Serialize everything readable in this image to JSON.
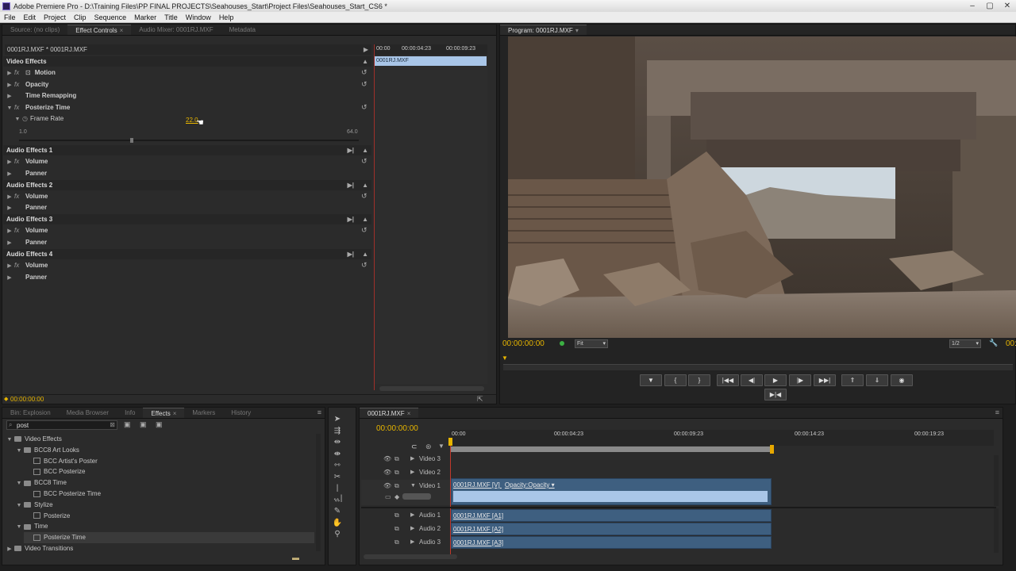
{
  "window": {
    "title": "Adobe Premiere Pro - D:\\Training Files\\PP FINAL PROJECTS\\Seahouses_Start\\Project Files\\Seahouses_Start_CS6 *"
  },
  "menu": [
    "File",
    "Edit",
    "Project",
    "Clip",
    "Sequence",
    "Marker",
    "Title",
    "Window",
    "Help"
  ],
  "top_left_tabs": [
    {
      "label": "Source: (no clips)"
    },
    {
      "label": "Effect Controls"
    },
    {
      "label": "Audio Mixer: 0001RJ.MXF"
    },
    {
      "label": "Metadata"
    }
  ],
  "effect_controls": {
    "header_clip": "0001RJ.MXF * 0001RJ.MXF",
    "ruler": [
      "00:00",
      "00:00:04:23",
      "00:00:09:23"
    ],
    "clip_label": "0001RJ.MXF",
    "sections": {
      "video": "Video Effects",
      "motion": "Motion",
      "opacity": "Opacity",
      "time_remapping": "Time Remapping",
      "posterize": "Posterize Time",
      "frame_rate_label": "Frame Rate",
      "frame_rate_value": "22.0",
      "slider_min": "1.0",
      "slider_max": "64.0",
      "audio1": "Audio Effects 1",
      "audio2": "Audio Effects 2",
      "audio3": "Audio Effects 3",
      "audio4": "Audio Effects 4",
      "volume": "Volume",
      "panner": "Panner"
    },
    "timecode": "00:00:00:00"
  },
  "program": {
    "tab": "Program: 0001RJ.MXF",
    "timecode": "00:00:00:00",
    "fit": "Fit",
    "resolution": "1/2",
    "end_timecode": "00:"
  },
  "bottom_left_tabs": [
    {
      "label": "Bin: Explosion"
    },
    {
      "label": "Media Browser"
    },
    {
      "label": "Info"
    },
    {
      "label": "Effects"
    },
    {
      "label": "Markers"
    },
    {
      "label": "History"
    }
  ],
  "effects_panel": {
    "search_value": "post",
    "tree": [
      {
        "label": "Video Effects",
        "indent": 0,
        "type": "folder",
        "tri": "▼"
      },
      {
        "label": "BCC8 Art Looks",
        "indent": 1,
        "type": "folder",
        "tri": "▼"
      },
      {
        "label": "BCC Artist's Poster",
        "indent": 2,
        "type": "fx",
        "tri": ""
      },
      {
        "label": "BCC Posterize",
        "indent": 2,
        "type": "fx",
        "tri": ""
      },
      {
        "label": "BCC8 Time",
        "indent": 1,
        "type": "folder",
        "tri": "▼"
      },
      {
        "label": "BCC Posterize Time",
        "indent": 2,
        "type": "fx",
        "tri": ""
      },
      {
        "label": "Stylize",
        "indent": 1,
        "type": "folder",
        "tri": "▼"
      },
      {
        "label": "Posterize",
        "indent": 2,
        "type": "fx",
        "tri": ""
      },
      {
        "label": "Time",
        "indent": 1,
        "type": "folder",
        "tri": "▼"
      },
      {
        "label": "Posterize Time",
        "indent": 2,
        "type": "fx",
        "tri": "",
        "selected": true
      },
      {
        "label": "Video Transitions",
        "indent": 0,
        "type": "folder",
        "tri": "▶"
      }
    ]
  },
  "timeline": {
    "tab": "0001RJ.MXF",
    "timecode": "00:00:00:00",
    "ruler": [
      "00:00",
      "00:00:04:23",
      "00:00:09:23",
      "00:00:14:23",
      "00:00:19:23"
    ],
    "tracks": {
      "v3": "Video 3",
      "v2": "Video 2",
      "v1": "Video 1",
      "a1": "Audio 1",
      "a2": "Audio 2",
      "a3": "Audio 3"
    },
    "clips": {
      "v1": "0001RJ.MXF [V]",
      "v1_fx": "Opacity:Opacity ▾",
      "a1": "0001RJ.MXF [A1]",
      "a2": "0001RJ.MXF [A2]",
      "a3": "0001RJ.MXF [A3]"
    }
  },
  "colors": {
    "accent_timecode": "#e7b500",
    "clip_blue": "#3e5f80",
    "selected_clip": "#a9c6e8"
  }
}
